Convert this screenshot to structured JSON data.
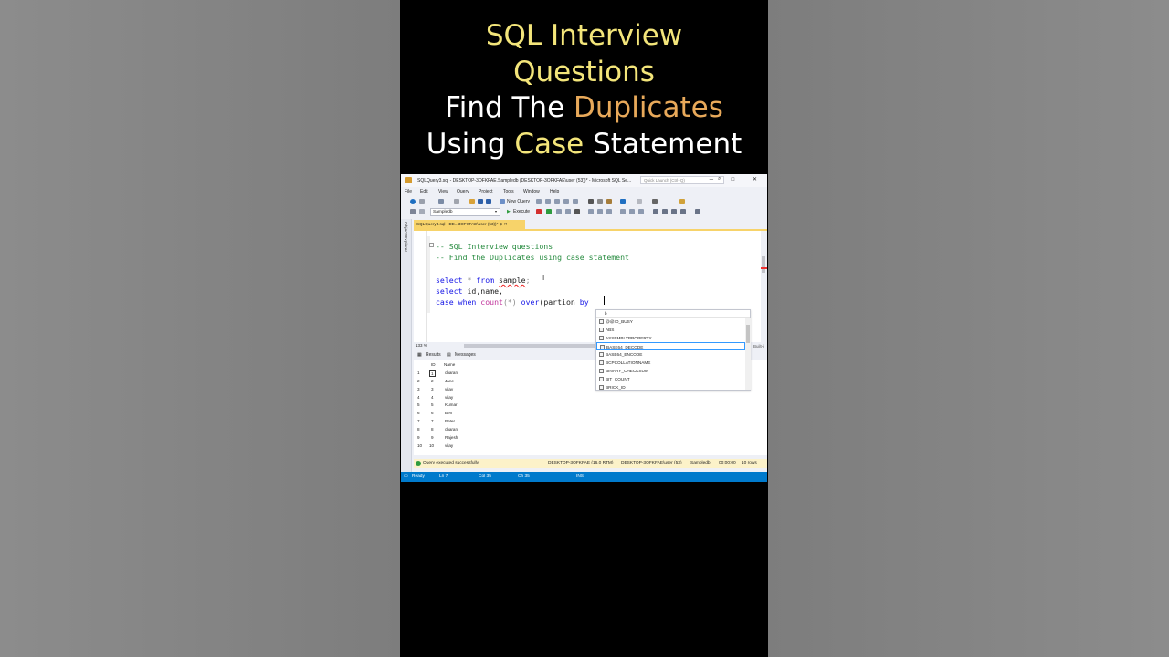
{
  "video_title": {
    "line1": "SQL Interview",
    "line2": "Questions",
    "line3_a": "Find The ",
    "line3_b": "Duplicates",
    "line4_a": "Using ",
    "line4_b": "Case",
    "line4_c": " Statement"
  },
  "window": {
    "title": "SQLQuery3.sql - DESKTOP-3OFKFAE.Sampledb (DESKTOP-3OFKFAE\\user (53))* - Microsoft SQL Se...",
    "quick_launch_placeholder": "Quick Launch (Ctrl+Q)",
    "controls": "─ □ ✕"
  },
  "menu": [
    "File",
    "Edit",
    "View",
    "Query",
    "Project",
    "Tools",
    "Window",
    "Help"
  ],
  "toolbar": {
    "new_query": "New Query",
    "database": "Sampledb",
    "execute": "Execute"
  },
  "object_explorer": "Object Explorer",
  "doc_tab": "SQLQuery3.sql - DE...3OFKFAE\\user (53))*  ⊕  ✕",
  "editor": {
    "comment1": "-- SQL Interview questions",
    "comment2": "-- Find the Duplicates using case statement",
    "l3_select": "select",
    "l3_star": " * ",
    "l3_from": "from",
    "l3_table": "sample",
    "l3_semi": ";",
    "l4_select": "select",
    "l4_rest": " id,name,",
    "l5_case": "case",
    "l5_when": " when ",
    "l5_count": "count",
    "l5_paren": "(*) ",
    "l5_over": "over",
    "l5_partion": "(partion ",
    "l5_by": "by"
  },
  "zoom": "133 %",
  "intellisense": {
    "filter": "b",
    "items": [
      "@@IO_BUSY",
      "ABS",
      "ASSEMBLYPROPERTY",
      "BASE64_DECODE",
      "BASE64_ENCODE",
      "BCPCOLLATIONNAME",
      "BINARY_CHECKSUM",
      "BIT_COUNT",
      "BRICK_ID"
    ],
    "selected_index": 3
  },
  "side_hint": "Built-i",
  "results_tabs": {
    "results": "Results",
    "messages": "Messages"
  },
  "results": {
    "columns": [
      "ID",
      "Name"
    ],
    "rows": [
      {
        "n": "1",
        "id": "1",
        "name": "charan"
      },
      {
        "n": "2",
        "id": "2",
        "name": "Jane"
      },
      {
        "n": "3",
        "id": "3",
        "name": "vijay"
      },
      {
        "n": "4",
        "id": "4",
        "name": "vijay"
      },
      {
        "n": "5",
        "id": "5",
        "name": "Kumar"
      },
      {
        "n": "6",
        "id": "6",
        "name": "Ben"
      },
      {
        "n": "7",
        "id": "7",
        "name": "Peter"
      },
      {
        "n": "8",
        "id": "8",
        "name": "charan"
      },
      {
        "n": "9",
        "id": "9",
        "name": "Rajesh"
      },
      {
        "n": "10",
        "id": "10",
        "name": "vijay"
      }
    ]
  },
  "query_status": {
    "message": "Query executed successfully.",
    "server": "DESKTOP-3OFKFAE (16.0 RTM)",
    "user": "DESKTOP-3OFKFAE\\user (53)",
    "db": "Sampledb",
    "time": "00:00:00",
    "rows": "10 rows"
  },
  "statusbar": {
    "ready": "Ready",
    "ln": "Ln 7",
    "col": "Col 35",
    "ch": "Ch 35",
    "ins": "INS"
  },
  "colors": {
    "title_yellow": "#f3e57a",
    "title_orange": "#e8a95a",
    "keyword": "#1515e6",
    "comment": "#248a3d",
    "function": "#c0339b",
    "statusbar": "#007acc",
    "tab_active": "#f7d36a"
  }
}
